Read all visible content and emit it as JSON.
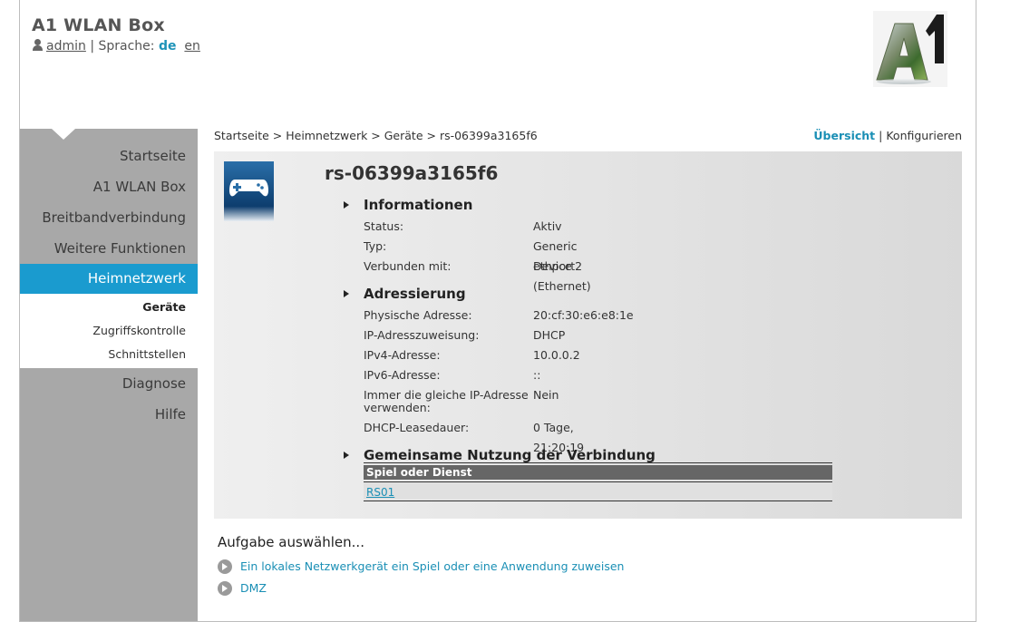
{
  "header": {
    "app_title": "A1 WLAN Box",
    "user": "admin",
    "language_label": "| Sprache:",
    "lang_de": "de",
    "lang_en": "en"
  },
  "logo_text": "A1",
  "sidebar": {
    "items": [
      {
        "label": "Startseite"
      },
      {
        "label": "A1 WLAN Box"
      },
      {
        "label": "Breitbandverbindung"
      },
      {
        "label": "Weitere Funktionen"
      },
      {
        "label": "Heimnetzwerk"
      },
      {
        "label": "Diagnose"
      },
      {
        "label": "Hilfe"
      }
    ],
    "sub_items": [
      {
        "label": "Geräte"
      },
      {
        "label": "Zugriffskontrolle"
      },
      {
        "label": "Schnittstellen"
      }
    ]
  },
  "breadcrumb": "Startseite > Heimnetzwerk > Geräte > rs-06399a3165f6",
  "view": {
    "overview": "Übersicht",
    "separator": "|",
    "configure": "Konfigurieren"
  },
  "device": {
    "title": "rs-06399a3165f6"
  },
  "info": {
    "heading": "Informationen",
    "rows": [
      {
        "label": "Status:",
        "value": "Aktiv"
      },
      {
        "label": "Typ:",
        "value": "Generic Device"
      },
      {
        "label": "Verbunden mit:",
        "value": "ethport2 (Ethernet)"
      }
    ]
  },
  "addressing": {
    "heading": "Adressierung",
    "rows": [
      {
        "label": "Physische Adresse:",
        "value": "20:cf:30:e6:e8:1e"
      },
      {
        "label": "IP-Adresszuweisung:",
        "value": "DHCP"
      },
      {
        "label": "IPv4-Adresse:",
        "value": "10.0.0.2"
      },
      {
        "label": "IPv6-Adresse:",
        "value": "::"
      },
      {
        "label": "Immer die gleiche IP-Adresse verwenden:",
        "value": "Nein"
      },
      {
        "label": "DHCP-Leasedauer:",
        "value": "0 Tage, 21:20:19"
      }
    ]
  },
  "sharing": {
    "heading": "Gemeinsame Nutzung der Verbindung",
    "column": "Spiel oder Dienst",
    "entries": [
      "RS01"
    ]
  },
  "tasks": {
    "title": "Aufgabe auswählen...",
    "items": [
      {
        "label": "Ein lokales Netzwerkgerät ein Spiel oder eine Anwendung zuweisen"
      },
      {
        "label": "DMZ"
      }
    ]
  },
  "colors": {
    "accent": "#1a9bcf",
    "sidebar": "#a8a8a8",
    "link": "#1a8fb5"
  }
}
